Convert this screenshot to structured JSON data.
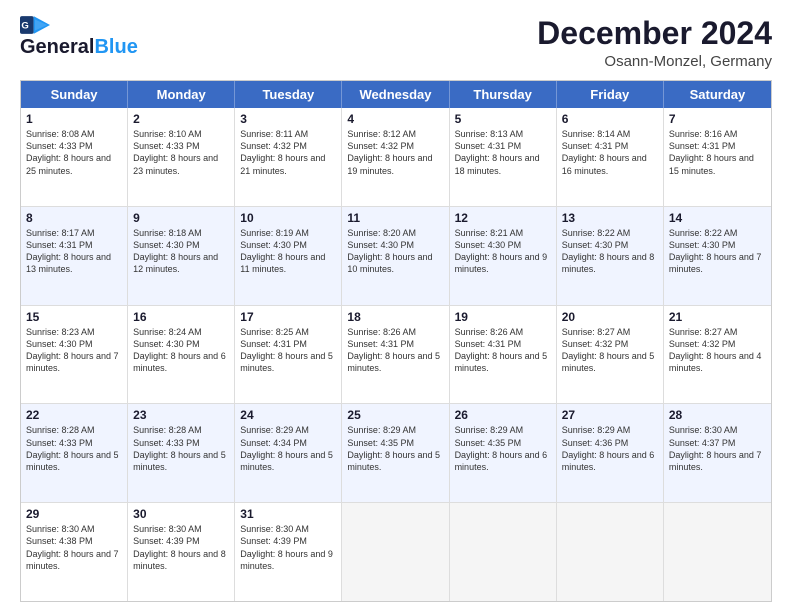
{
  "header": {
    "logo_line1": "General",
    "logo_line2": "Blue",
    "month_title": "December 2024",
    "location": "Osann-Monzel, Germany"
  },
  "weekdays": [
    "Sunday",
    "Monday",
    "Tuesday",
    "Wednesday",
    "Thursday",
    "Friday",
    "Saturday"
  ],
  "rows": [
    [
      {
        "day": "1",
        "sunrise": "8:08 AM",
        "sunset": "4:33 PM",
        "daylight": "8 hours and 25 minutes."
      },
      {
        "day": "2",
        "sunrise": "8:10 AM",
        "sunset": "4:33 PM",
        "daylight": "8 hours and 23 minutes."
      },
      {
        "day": "3",
        "sunrise": "8:11 AM",
        "sunset": "4:32 PM",
        "daylight": "8 hours and 21 minutes."
      },
      {
        "day": "4",
        "sunrise": "8:12 AM",
        "sunset": "4:32 PM",
        "daylight": "8 hours and 19 minutes."
      },
      {
        "day": "5",
        "sunrise": "8:13 AM",
        "sunset": "4:31 PM",
        "daylight": "8 hours and 18 minutes."
      },
      {
        "day": "6",
        "sunrise": "8:14 AM",
        "sunset": "4:31 PM",
        "daylight": "8 hours and 16 minutes."
      },
      {
        "day": "7",
        "sunrise": "8:16 AM",
        "sunset": "4:31 PM",
        "daylight": "8 hours and 15 minutes."
      }
    ],
    [
      {
        "day": "8",
        "sunrise": "8:17 AM",
        "sunset": "4:31 PM",
        "daylight": "8 hours and 13 minutes."
      },
      {
        "day": "9",
        "sunrise": "8:18 AM",
        "sunset": "4:30 PM",
        "daylight": "8 hours and 12 minutes."
      },
      {
        "day": "10",
        "sunrise": "8:19 AM",
        "sunset": "4:30 PM",
        "daylight": "8 hours and 11 minutes."
      },
      {
        "day": "11",
        "sunrise": "8:20 AM",
        "sunset": "4:30 PM",
        "daylight": "8 hours and 10 minutes."
      },
      {
        "day": "12",
        "sunrise": "8:21 AM",
        "sunset": "4:30 PM",
        "daylight": "8 hours and 9 minutes."
      },
      {
        "day": "13",
        "sunrise": "8:22 AM",
        "sunset": "4:30 PM",
        "daylight": "8 hours and 8 minutes."
      },
      {
        "day": "14",
        "sunrise": "8:22 AM",
        "sunset": "4:30 PM",
        "daylight": "8 hours and 7 minutes."
      }
    ],
    [
      {
        "day": "15",
        "sunrise": "8:23 AM",
        "sunset": "4:30 PM",
        "daylight": "8 hours and 7 minutes."
      },
      {
        "day": "16",
        "sunrise": "8:24 AM",
        "sunset": "4:30 PM",
        "daylight": "8 hours and 6 minutes."
      },
      {
        "day": "17",
        "sunrise": "8:25 AM",
        "sunset": "4:31 PM",
        "daylight": "8 hours and 5 minutes."
      },
      {
        "day": "18",
        "sunrise": "8:26 AM",
        "sunset": "4:31 PM",
        "daylight": "8 hours and 5 minutes."
      },
      {
        "day": "19",
        "sunrise": "8:26 AM",
        "sunset": "4:31 PM",
        "daylight": "8 hours and 5 minutes."
      },
      {
        "day": "20",
        "sunrise": "8:27 AM",
        "sunset": "4:32 PM",
        "daylight": "8 hours and 5 minutes."
      },
      {
        "day": "21",
        "sunrise": "8:27 AM",
        "sunset": "4:32 PM",
        "daylight": "8 hours and 4 minutes."
      }
    ],
    [
      {
        "day": "22",
        "sunrise": "8:28 AM",
        "sunset": "4:33 PM",
        "daylight": "8 hours and 5 minutes."
      },
      {
        "day": "23",
        "sunrise": "8:28 AM",
        "sunset": "4:33 PM",
        "daylight": "8 hours and 5 minutes."
      },
      {
        "day": "24",
        "sunrise": "8:29 AM",
        "sunset": "4:34 PM",
        "daylight": "8 hours and 5 minutes."
      },
      {
        "day": "25",
        "sunrise": "8:29 AM",
        "sunset": "4:35 PM",
        "daylight": "8 hours and 5 minutes."
      },
      {
        "day": "26",
        "sunrise": "8:29 AM",
        "sunset": "4:35 PM",
        "daylight": "8 hours and 6 minutes."
      },
      {
        "day": "27",
        "sunrise": "8:29 AM",
        "sunset": "4:36 PM",
        "daylight": "8 hours and 6 minutes."
      },
      {
        "day": "28",
        "sunrise": "8:30 AM",
        "sunset": "4:37 PM",
        "daylight": "8 hours and 7 minutes."
      }
    ],
    [
      {
        "day": "29",
        "sunrise": "8:30 AM",
        "sunset": "4:38 PM",
        "daylight": "8 hours and 7 minutes."
      },
      {
        "day": "30",
        "sunrise": "8:30 AM",
        "sunset": "4:39 PM",
        "daylight": "8 hours and 8 minutes."
      },
      {
        "day": "31",
        "sunrise": "8:30 AM",
        "sunset": "4:39 PM",
        "daylight": "8 hours and 9 minutes."
      },
      null,
      null,
      null,
      null
    ]
  ],
  "row_alt": [
    false,
    true,
    false,
    true,
    false
  ],
  "labels": {
    "sunrise_prefix": "Sunrise: ",
    "sunset_prefix": "Sunset: ",
    "daylight_prefix": "Daylight: "
  }
}
